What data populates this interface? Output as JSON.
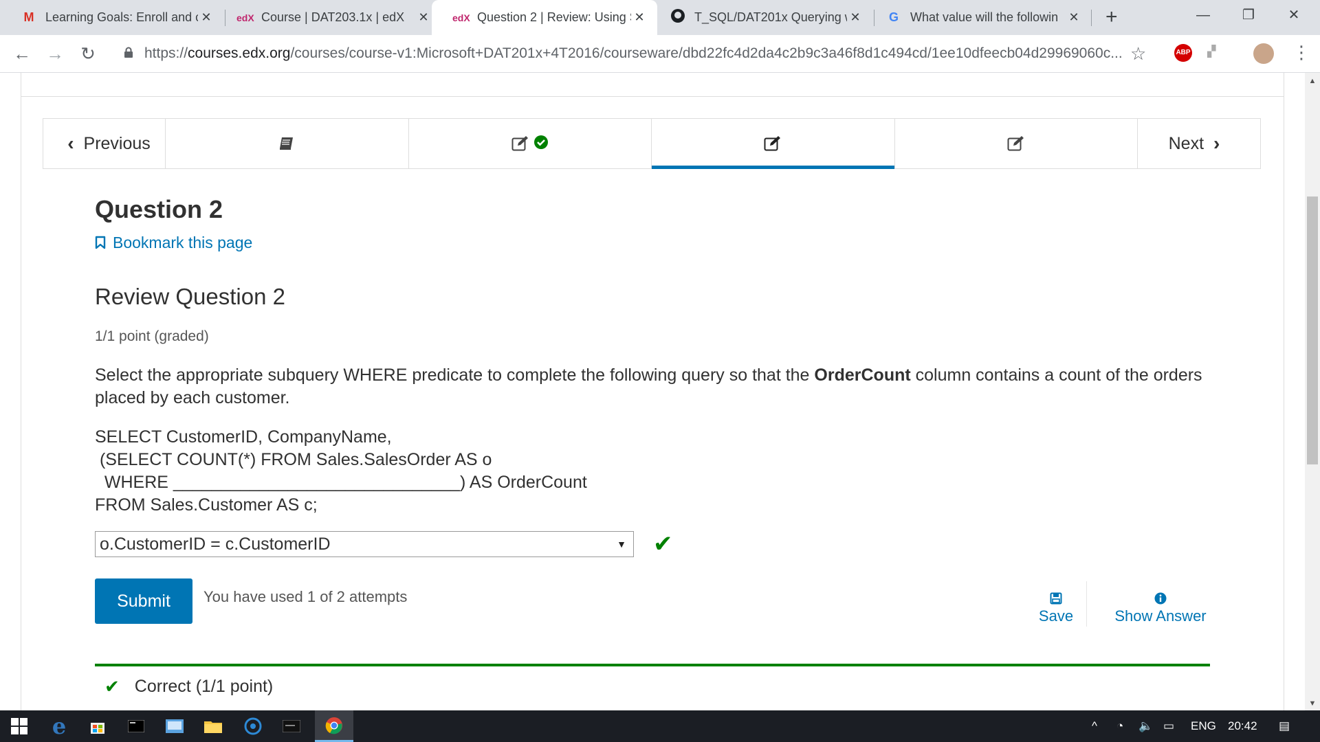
{
  "browser": {
    "tabs": [
      {
        "title": "Learning Goals: Enroll and c",
        "icon": "gmail-icon",
        "active": false
      },
      {
        "title": "Course | DAT203.1x | edX",
        "icon": "edx-icon",
        "active": false
      },
      {
        "title": "Question 2 | Review: Using S",
        "icon": "edx-icon",
        "active": true
      },
      {
        "title": "T_SQL/DAT201x Querying w",
        "icon": "github-icon",
        "active": false
      },
      {
        "title": "What value will the followin",
        "icon": "google-icon",
        "active": false
      }
    ],
    "url_prefix": "https://",
    "url_host": "courses.edx.org",
    "url_path": "/courses/course-v1:Microsoft+DAT201x+4T2016/courseware/dbd22fc4d2da4c2b9c3a46f8d1c494cd/1ee10dfeecb04d29969060c...",
    "extension_abp": "ABP"
  },
  "seqnav": {
    "previous_label": "Previous",
    "next_label": "Next",
    "units": [
      {
        "icon": "book-icon",
        "completed": false,
        "active": false
      },
      {
        "icon": "edit-icon",
        "completed": true,
        "active": false
      },
      {
        "icon": "edit-icon",
        "completed": false,
        "active": true
      },
      {
        "icon": "edit-icon",
        "completed": false,
        "active": false
      }
    ]
  },
  "page": {
    "title": "Question 2",
    "bookmark_label": "Bookmark this page",
    "problem_title": "Review Question 2",
    "points": "1/1 point (graded)",
    "prompt_before": "Select the appropriate subquery WHERE predicate to complete the following query so that the ",
    "prompt_bold": "OrderCount",
    "prompt_after": " column contains a count of the orders placed by each customer.",
    "code_lines": [
      "SELECT CustomerID, CompanyName,",
      " (SELECT COUNT(*) FROM Sales.SalesOrder AS o",
      "  WHERE ______________________________) AS OrderCount",
      "FROM Sales.Customer AS c;"
    ],
    "selected_answer": "o.CustomerID = c.CustomerID",
    "submit_label": "Submit",
    "attempts_text": "You have used 1 of 2 attempts",
    "save_label": "Save",
    "show_answer_label": "Show Answer",
    "status_text": "Correct (1/1 point)"
  },
  "taskbar": {
    "language": "ENG",
    "time": "20:42"
  },
  "colors": {
    "accent": "#0075b4",
    "success": "#008100",
    "text": "#313131"
  }
}
